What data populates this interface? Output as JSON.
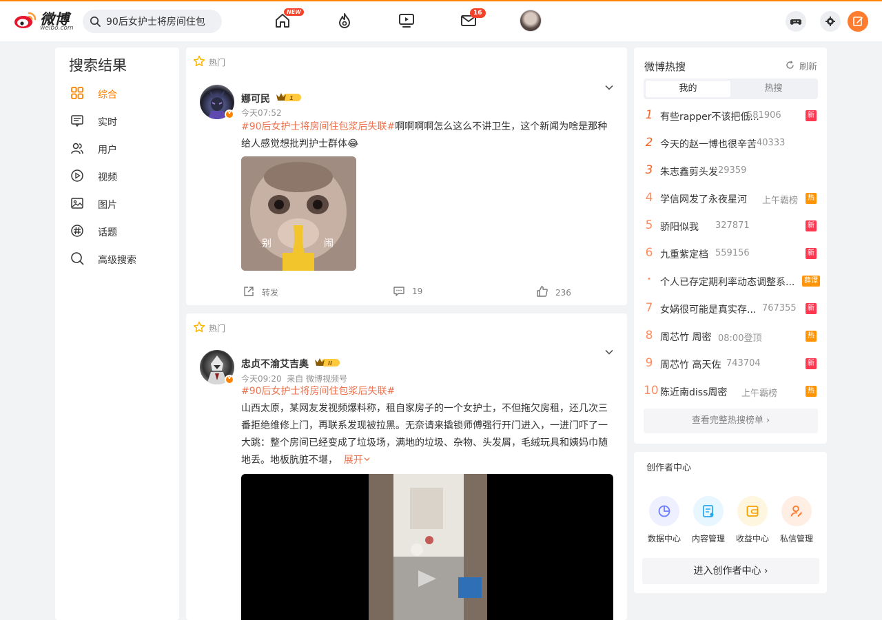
{
  "header": {
    "logo_text": "微博",
    "logo_domain": "weibo.com",
    "search_value": "90后女护士将房间住包",
    "nav": [
      {
        "name": "home",
        "badge": "NEW"
      },
      {
        "name": "hot"
      },
      {
        "name": "video"
      },
      {
        "name": "messages",
        "badge": "16"
      }
    ]
  },
  "sidebar": {
    "title": "搜索结果",
    "items": [
      {
        "label": "综合",
        "icon": "grid-icon",
        "active": true
      },
      {
        "label": "实时",
        "icon": "realtime-icon"
      },
      {
        "label": "用户",
        "icon": "users-icon"
      },
      {
        "label": "视频",
        "icon": "video-icon"
      },
      {
        "label": "图片",
        "icon": "image-icon"
      },
      {
        "label": "话题",
        "icon": "topic-icon"
      },
      {
        "label": "高级搜索",
        "icon": "search-icon"
      }
    ]
  },
  "posts": [
    {
      "hot_label": "热门",
      "author": "娜可民",
      "vip_level": "1",
      "time": "今天07:52",
      "topic": "#90后女护士将房间住包浆后失联#",
      "text": "啊啊啊啊怎么这么不讲卫生，这个新闻为啥是那种给人感觉想批判护士群体😂",
      "image_caption_left": "别",
      "image_caption_right": "闹",
      "repost_label": "转发",
      "comments": "19",
      "likes": "236"
    },
    {
      "hot_label": "热门",
      "author": "忠贞不渝艾吉奥",
      "vip_level": "II",
      "time": "今天09:20",
      "source": "来自 微博视频号",
      "topic": "#90后女护士将房间住包浆后失联#",
      "text": "山西太原，某网友发视频爆料称，租自家房子的一个女护士，不但拖欠房租，还几次三番拒绝维修上门，再联系发现被拉黑。无奈请来撬锁师傅强行开门进入，一进门吓了一大跳：整个房间已经变成了垃圾场，满地的垃圾、杂物、头发屑，毛绒玩具和姨妈巾随地丢。地板肮脏不堪，",
      "expand_label": "展开"
    }
  ],
  "hot_search": {
    "title": "微博热搜",
    "refresh_label": "刷新",
    "tabs": [
      "我的",
      "热搜"
    ],
    "items": [
      {
        "rank": "1",
        "word": "有些rapper不该把低...",
        "num": "581906",
        "flag": "新",
        "flag_color": "#ff3852"
      },
      {
        "rank": "2",
        "word": "今天的赵一博也很辛苦",
        "num": "40333",
        "flag": ""
      },
      {
        "rank": "3",
        "word": "朱志鑫剪头发",
        "num": "29359",
        "flag": ""
      },
      {
        "rank": "4",
        "word": "学信网发了永夜星河",
        "num": "上午霸榜",
        "flag": "热",
        "flag_color": "#ff9406"
      },
      {
        "rank": "5",
        "word": "骄阳似我",
        "num": "327871",
        "flag": "新",
        "flag_color": "#ff3852"
      },
      {
        "rank": "6",
        "word": "九重紫定档",
        "num": "559156",
        "flag": "新",
        "flag_color": "#ff3852"
      },
      {
        "rank": "•",
        "word": "个人已存定期利率动态调整系...",
        "num": "",
        "flag": "薛谭",
        "flag_color": "#ff9406"
      },
      {
        "rank": "7",
        "word": "女娲很可能是真实存...",
        "num": "767355",
        "flag": "新",
        "flag_color": "#ff3852"
      },
      {
        "rank": "8",
        "word": "周芯竹 周密",
        "num": "08:00登顶",
        "flag": "热",
        "flag_color": "#ff9406"
      },
      {
        "rank": "9",
        "word": "周芯竹 高天佐",
        "num": "743704",
        "flag": "新",
        "flag_color": "#ff3852"
      },
      {
        "rank": "10",
        "word": "陈近南diss周密",
        "num": "上午霸榜",
        "flag": "热",
        "flag_color": "#ff9406"
      }
    ],
    "more_label": "查看完整热搜榜单 ›"
  },
  "creator": {
    "title": "创作者中心",
    "items": [
      {
        "label": "数据中心",
        "icon": "chart-icon",
        "bg": "#eef0ff",
        "fg": "#6a7cff"
      },
      {
        "label": "内容管理",
        "icon": "document-icon",
        "bg": "#e8f6ff",
        "fg": "#22a7f0"
      },
      {
        "label": "收益中心",
        "icon": "wallet-icon",
        "bg": "#fff6e0",
        "fg": "#f5a200"
      },
      {
        "label": "私信管理",
        "icon": "user-edit-icon",
        "bg": "#ffeee4",
        "fg": "#ff7a2e"
      }
    ],
    "enter_label": "进入创作者中心 ›"
  }
}
